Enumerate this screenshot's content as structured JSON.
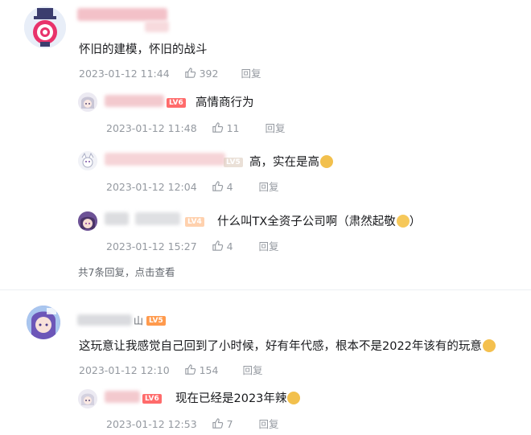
{
  "threads": [
    {
      "text": "怀旧的建模，怀旧的战斗",
      "date": "2023-01-12 11:44",
      "likes": "392",
      "reply_label": "回复",
      "level": "",
      "replies": [
        {
          "level": "LV6",
          "text": "高情商行为",
          "date": "2023-01-12 11:48",
          "likes": "11",
          "reply_label": "回复"
        },
        {
          "level": "LV5",
          "text": "高，实在是高",
          "date": "2023-01-12 12:04",
          "likes": "4",
          "reply_label": "回复"
        },
        {
          "level": "LV4",
          "text": "什么叫TX全资子公司啊（肃然起敬",
          "text_end": "）",
          "date": "2023-01-12 15:27",
          "likes": "4",
          "reply_label": "回复"
        }
      ],
      "more": {
        "count_text": "共7条回复，",
        "link_text": "点击查看"
      }
    },
    {
      "name_tail": "山",
      "level": "LV5",
      "text": "这玩意让我感觉自己回到了小时候，好有年代感，根本不是2022年该有的玩意",
      "date": "2023-01-12 12:10",
      "likes": "154",
      "reply_label": "回复",
      "replies": [
        {
          "level": "LV6",
          "text": "现在已经是2023年辣",
          "date": "2023-01-12 12:53",
          "likes": "7",
          "reply_label": "回复"
        }
      ]
    }
  ],
  "icons": {
    "like": "thumbs-up-icon",
    "emoji_doge": "doge-emoji-icon",
    "emoji_smile": "smile-emoji-icon",
    "emoji_laugh": "laugh-emoji-icon"
  },
  "colors": {
    "text": "#18191c",
    "meta": "#9499a0",
    "accent": "#00aeec"
  }
}
